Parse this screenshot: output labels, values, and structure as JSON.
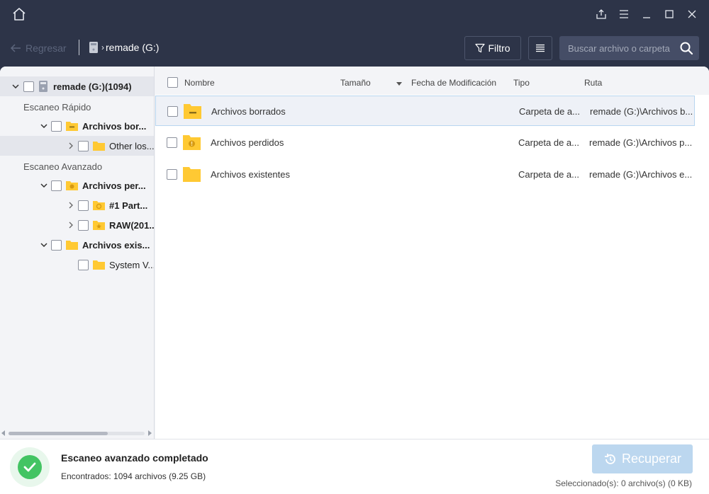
{
  "window": {
    "icons": {
      "home": "home-icon",
      "share": "share-icon",
      "menu": "menu-icon",
      "minimize": "minimize-icon",
      "maximize": "maximize-icon",
      "close": "close-icon"
    }
  },
  "toolbar": {
    "back_label": "Regresar",
    "breadcrumb_drive": "remade (G:)",
    "filter_label": "Filtro",
    "search_placeholder": "Buscar archivo o carpeta"
  },
  "tree": {
    "root": {
      "label": "remade (G:)(1094)"
    },
    "quick_scan_label": "Escaneo Rápido",
    "advanced_scan_label": "Escaneo Avanzado",
    "items": [
      {
        "label": "Archivos bor..."
      },
      {
        "label": "Other los..."
      },
      {
        "label": "Archivos per..."
      },
      {
        "label": "#1 Part..."
      },
      {
        "label": "RAW(201..."
      },
      {
        "label": "Archivos exis..."
      },
      {
        "label": "System V..."
      }
    ]
  },
  "list": {
    "columns": {
      "name": "Nombre",
      "size": "Tamaño",
      "date": "Fecha de Modificación",
      "type": "Tipo",
      "path": "Ruta"
    },
    "rows": [
      {
        "name": "Archivos borrados",
        "type": "Carpeta de a...",
        "path": "remade (G:)\\Archivos b..."
      },
      {
        "name": "Archivos perdidos",
        "type": "Carpeta de a...",
        "path": "remade (G:)\\Archivos p..."
      },
      {
        "name": "Archivos existentes",
        "type": "Carpeta de a...",
        "path": "remade (G:)\\Archivos e..."
      }
    ]
  },
  "status": {
    "title": "Escaneo avanzado completado",
    "found": "Encontrados: 1094 archivos (9.25 GB)",
    "recover_label": "Recuperar",
    "selected_info": "Seleccionado(s): 0 archivo(s) (0 KB)"
  },
  "colors": {
    "titlebar": "#2d3448",
    "folder": "#ffc933",
    "success": "#43c463",
    "recover_disabled": "#bcd7ef"
  }
}
